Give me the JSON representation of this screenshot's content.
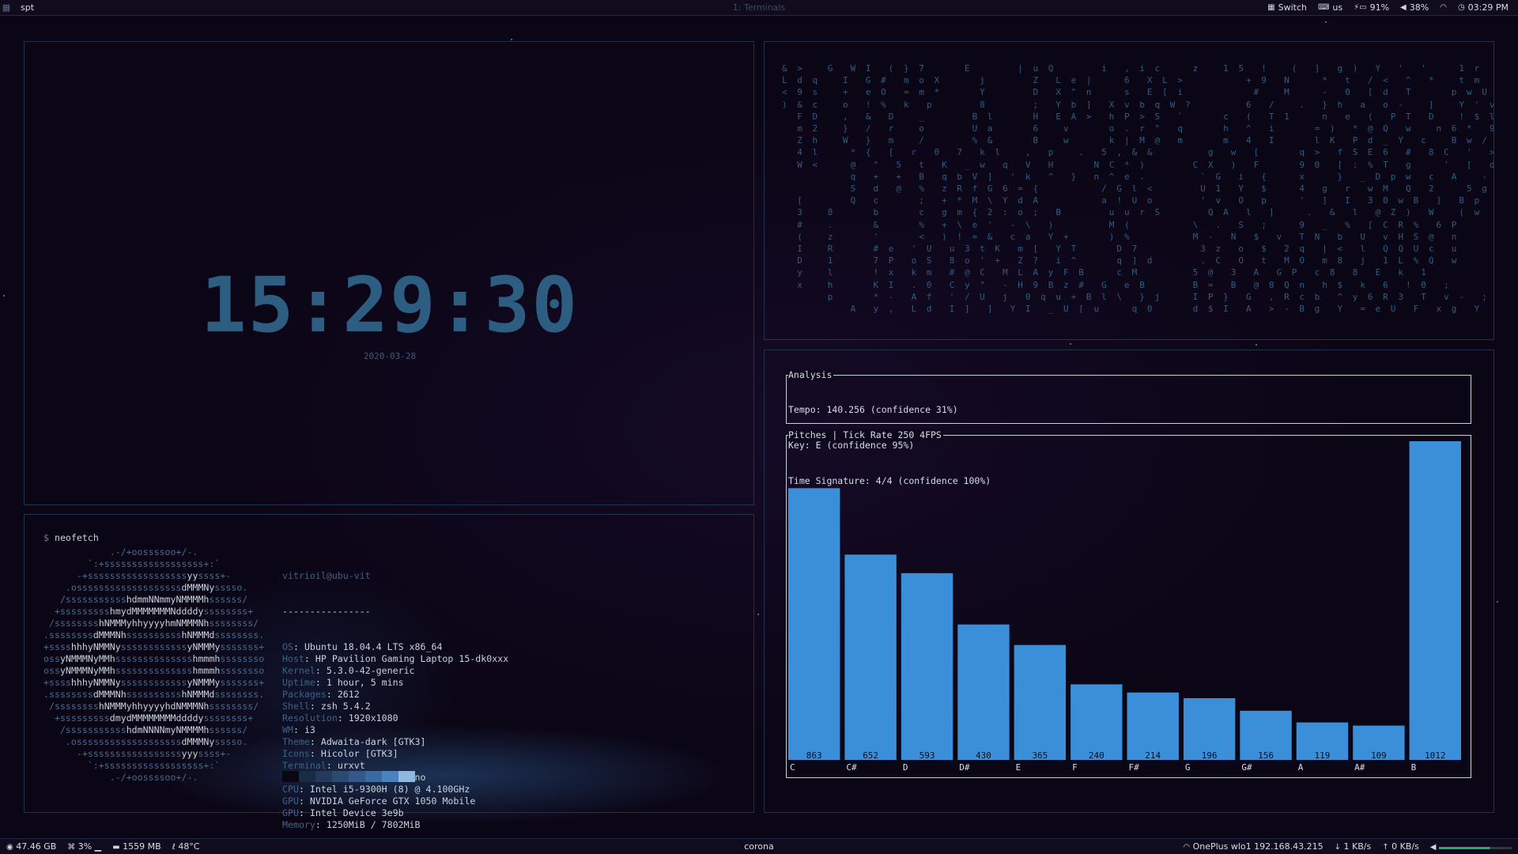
{
  "topbar": {
    "workspace": "spt",
    "window_title": "1: Terminals",
    "switch_label": "Switch",
    "keyboard_layout": "us",
    "battery": "91%",
    "volume": "38%",
    "clock": "03:29 PM"
  },
  "clock": {
    "time": "15:29:30",
    "date": "2020-03-28"
  },
  "neofetch": {
    "prompt_symbol": "$",
    "command": "neofetch",
    "user_host": "vitrioil@ubu-vit",
    "separator": "----------------",
    "fields": [
      {
        "key": "OS",
        "value": "Ubuntu 18.04.4 LTS x86_64"
      },
      {
        "key": "Host",
        "value": "HP Pavilion Gaming Laptop 15-dk0xxx"
      },
      {
        "key": "Kernel",
        "value": "5.3.0-42-generic"
      },
      {
        "key": "Uptime",
        "value": "1 hour, 5 mins"
      },
      {
        "key": "Packages",
        "value": "2612"
      },
      {
        "key": "Shell",
        "value": "zsh 5.4.2"
      },
      {
        "key": "Resolution",
        "value": "1920x1080"
      },
      {
        "key": "WM",
        "value": "i3"
      },
      {
        "key": "Theme",
        "value": "Adwaita-dark [GTK3]"
      },
      {
        "key": "Icons",
        "value": "Hicolor [GTK3]"
      },
      {
        "key": "Terminal",
        "value": "urxvt"
      },
      {
        "key": "Terminal Font",
        "value": "Ubuntu Mono"
      },
      {
        "key": "CPU",
        "value": "Intel i5-9300H (8) @ 4.100GHz"
      },
      {
        "key": "GPU",
        "value": "NVIDIA GeForce GTX 1050 Mobile"
      },
      {
        "key": "GPU",
        "value": "Intel Device 3e9b"
      },
      {
        "key": "Memory",
        "value": "1250MiB / 7802MiB"
      }
    ],
    "logo": [
      "            .-/+oossssoo+/-.",
      "        `:+ssssssssssssssssss+:`",
      "      -+ssssssssssssssssssyyssss+-",
      "    .osssssssssssssssssssdMMMNysssso.",
      "   /ssssssssssshdmmNNmmyNMMMMhssssss/",
      "  +ssssssssshmydMMMMMMMNddddyssssssss+",
      " /sssssssshNMMMyhhyyyyhmNMMMNhssssssss/",
      ".ssssssssdMMMNhsssssssssshNMMMdssssssss.",
      "+sssshhhyNMMNyssssssssssssyNMMMysssssss+",
      "ossyNMMMNyMMhsssssssssssssshmmmhssssssso",
      "ossyNMMMNyMMhsssssssssssssshmmmhssssssso",
      "+sssshhhyNMMNyssssssssssssyNMMMysssssss+",
      ".ssssssssdMMMNhsssssssssshNMMMdssssssss.",
      " /sssssssshNMMMyhhyyyyhdNMMMNhssssssss/",
      "  +sssssssssdmydMMMMMMMMddddyssssssss+",
      "   /ssssssssssshdmNNNNmyNMMMMhssssss/",
      "    .osssssssssssssssssssdMMMNysssso.",
      "      -+sssssssssssssssssyyyssss+-",
      "        `:+ssssssssssssssssss+:`",
      "            .-/+oossssoo+/-."
    ],
    "palette": [
      "#0a0612",
      "#1b2b44",
      "#223a5c",
      "#2a4a70",
      "#32598a",
      "#3a6aa0",
      "#4a82c0",
      "#8fb8e0"
    ]
  },
  "matrix": {
    "lines": [
      "& >   G  W I  ( } 7     E      | u Q      i  , i c    z   1 5  !   (  ]  g )  Y  '  '    1 r",
      "L d q   I  G #  m o X     j      Z  L e |    6  X L >        + 9  N    *  t  / <  ^  *   t m  Z B",
      "< 9 s   +  e O  = m *     Y      D  X \" n    s  E [ i         #   M    -  0  [ d  T     p w U  y {",
      ") & c   o  ! %  k  p      8      ;  Y b ]  X v b q W ?       6  /   .  } h  a  o -   ]   Y ' v  S",
      "  F D   ,  &  D   _      B l     H  E A >  h P > S  `     c  (  T 1    n  e  (  P T  D   ! $ l  c",
      "  m 2   }  /  r   o      U a     6   v     o . r \"  q     h  ^  i     = )  * @ Q  w   n 6 *  9",
      "  Z h   W  }  m   /      % &     B   w     k | M @  m     m  4  I     l K  P d _ Y  c   B w /  Z",
      "  4 l    * {  [  r  0  7  k l   ,  p   .  5 , & &       g  w  [     q >  f S E 6  #  8 C  '  >  9",
      "  W <    @  \"  5  t  K  _ w  q  V  H     N C * )      C X  )  F     9 0  [ : % T  g    '  [  d",
      "         q  +  +  B  q b V ]  ' k  ^  }  n ^ e .       ` G  i  {    x    }  _ D p w  c  A   - ;",
      "         S  d  @  %  z R f G 6 = {        / G l <      U 1  Y  $    4  g  r  w M  Q  2    5 g 8",
      "  [      Q  c     ;  + * M \\ Y d A        a ! U o      ' v  O  p    '  ]  I  3 0 w B  ]  B p",
      "  3   8     b     c  g m { 2 : o ;  B      u u r S      Q A  l  ]    .  &  l  @ Z )  W   ( w",
      "  #   .     &     %  + \\ e '  - \\  )       M (        \\  .  S  ;    9  _  %  [ C R %  6 P",
      "  (   z     '     <  ) ! = &  c a  Y +     ) %        M -  N  $  v  T N  b  U  v H S @  n",
      "  I   R     # e  ' U  u 3 t K  m [  Y T     D 7        3 z  o  $  2 q  | <  l  Q Q U c  u",
      "  D   1     7 P  o S  8 o ' +  Z ?  i ^     q ] d      . C  O  t  M O  m 8  j  1 L % Q  w",
      "  y   l     ! x  k m  # @ C  M L A y F B    c M       5 @  3  A  G P  c 8  8  E  k  1",
      "  x   h     K I  . 0  C y \"  - H 9 B z #  G  e B      B =  B  @ 8 Q n  h $  k  6  ! 0  ;",
      "      p     * -  A f  ' / U  j  0 q u + B l \\  } j    I P }  G  , R c b  ^ y 6 R 3  T  v -  ;",
      "         A  y ,  L d  I ]  ]  Y I  _ U [ u    q 0     d $ I  A  > - B g  Y  = e U  F  x g  Y"
    ]
  },
  "spt": {
    "analysis_title": "Analysis",
    "analysis_lines": [
      "Tempo: 140.256 (confidence 31%)",
      "Key: E (confidence 95%)",
      "Time Signature: 4/4 (confidence 100%)"
    ],
    "pitches_title": "Pitches | Tick Rate 250 4FPS"
  },
  "chart_data": {
    "type": "bar",
    "title": "Pitches | Tick Rate 250 4FPS",
    "categories": [
      "C",
      "C#",
      "D",
      "D#",
      "E",
      "F",
      "F#",
      "G",
      "G#",
      "A",
      "A#",
      "B"
    ],
    "values": [
      863,
      652,
      593,
      430,
      365,
      240,
      214,
      196,
      156,
      119,
      109,
      1012
    ],
    "ylim": [
      0,
      1012
    ],
    "grid": false,
    "bar_color": "#3a8fd8"
  },
  "bottombar": {
    "disk": "47.46 GB",
    "cpu": "3%",
    "mem": "1559 MB",
    "temp": "48°C",
    "host": "corona",
    "wifi": "OnePlus wlo1 192.168.43.215",
    "down": "1 KB/s",
    "up": "0 KB/s"
  }
}
